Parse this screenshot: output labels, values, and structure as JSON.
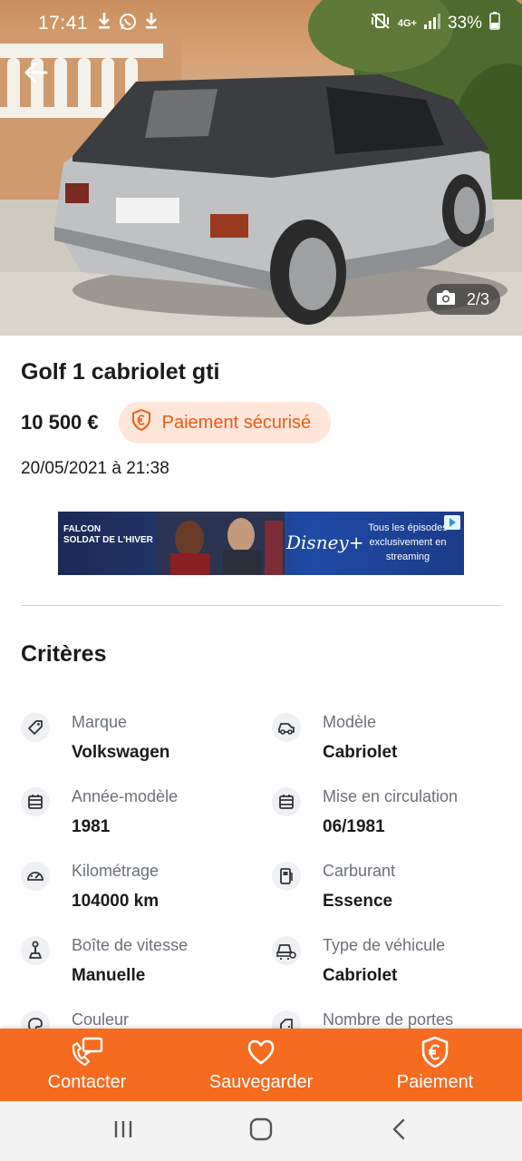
{
  "status_bar": {
    "time": "17:41",
    "notification_icons": [
      "download-icon",
      "whatsapp-icon",
      "download-icon"
    ],
    "network_label": "4G+",
    "battery": "33%"
  },
  "hero": {
    "photo_counter": "2/3",
    "back_icon": "arrow-left-icon",
    "camera_icon": "camera-icon"
  },
  "listing": {
    "title": "Golf 1 cabriolet gti",
    "price": "10 500 €",
    "secure_payment": "Paiement sécurisé",
    "date": "20/05/2021 à 21:38"
  },
  "ad": {
    "left_text_1": "FALCON",
    "left_text_2": "SOLDAT DE L'HIVER",
    "brand": "Disney+",
    "text": "Tous les épisodes exclusivement en streaming"
  },
  "criteria": {
    "title": "Critères",
    "items": [
      {
        "label": "Marque",
        "value": "Volkswagen",
        "icon": "tag-icon"
      },
      {
        "label": "Modèle",
        "value": "Cabriolet",
        "icon": "car-icon"
      },
      {
        "label": "Année-modèle",
        "value": "1981",
        "icon": "calendar-icon"
      },
      {
        "label": "Mise en circulation",
        "value": "06/1981",
        "icon": "calendar-icon"
      },
      {
        "label": "Kilométrage",
        "value": "104000 km",
        "icon": "speedometer-icon"
      },
      {
        "label": "Carburant",
        "value": "Essence",
        "icon": "fuel-pump-icon"
      },
      {
        "label": "Boîte de vitesse",
        "value": "Manuelle",
        "icon": "gear-shift-icon"
      },
      {
        "label": "Type de véhicule",
        "value": "Cabriolet",
        "icon": "vehicle-type-icon"
      },
      {
        "label": "Couleur",
        "value": "",
        "icon": "palette-icon"
      },
      {
        "label": "Nombre de portes",
        "value": "",
        "icon": "car-door-icon"
      }
    ]
  },
  "actions": {
    "contact": "Contacter",
    "save": "Sauvegarder",
    "payment": "Paiement"
  },
  "colors": {
    "accent": "#f56b1f",
    "badge_bg": "#ffe6d9",
    "badge_text": "#ec5a13"
  }
}
